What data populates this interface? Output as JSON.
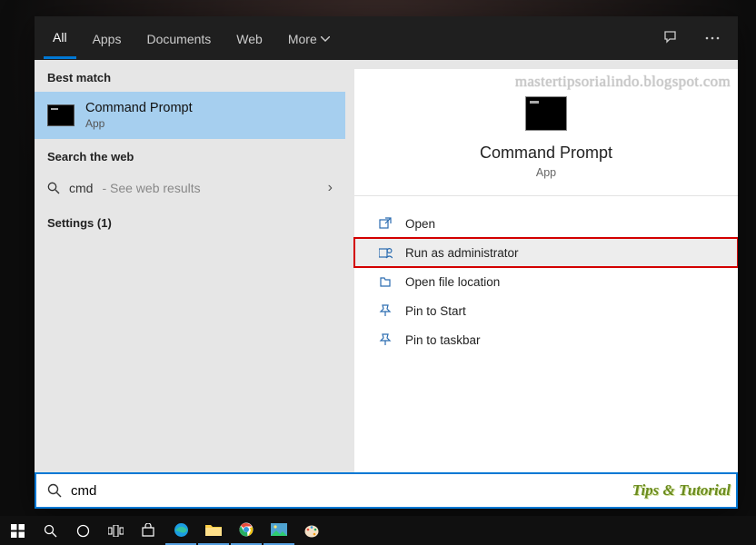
{
  "tabs": {
    "all": "All",
    "apps": "Apps",
    "documents": "Documents",
    "web": "Web",
    "more": "More"
  },
  "left": {
    "best_match_label": "Best match",
    "result": {
      "title": "Command Prompt",
      "sub": "App"
    },
    "search_web_label": "Search the web",
    "web_query": "cmd",
    "see_web": " - See web results",
    "settings_label": "Settings (1)"
  },
  "right": {
    "watermark": "mastertipsorialindo.blogspot.com",
    "title": "Command Prompt",
    "sub": "App",
    "actions": {
      "open": "Open",
      "run_admin": "Run as administrator",
      "open_loc": "Open file location",
      "pin_start": "Pin to Start",
      "pin_taskbar": "Pin to taskbar"
    }
  },
  "search": {
    "value": "cmd",
    "tips": "Tips & Tutorial"
  }
}
